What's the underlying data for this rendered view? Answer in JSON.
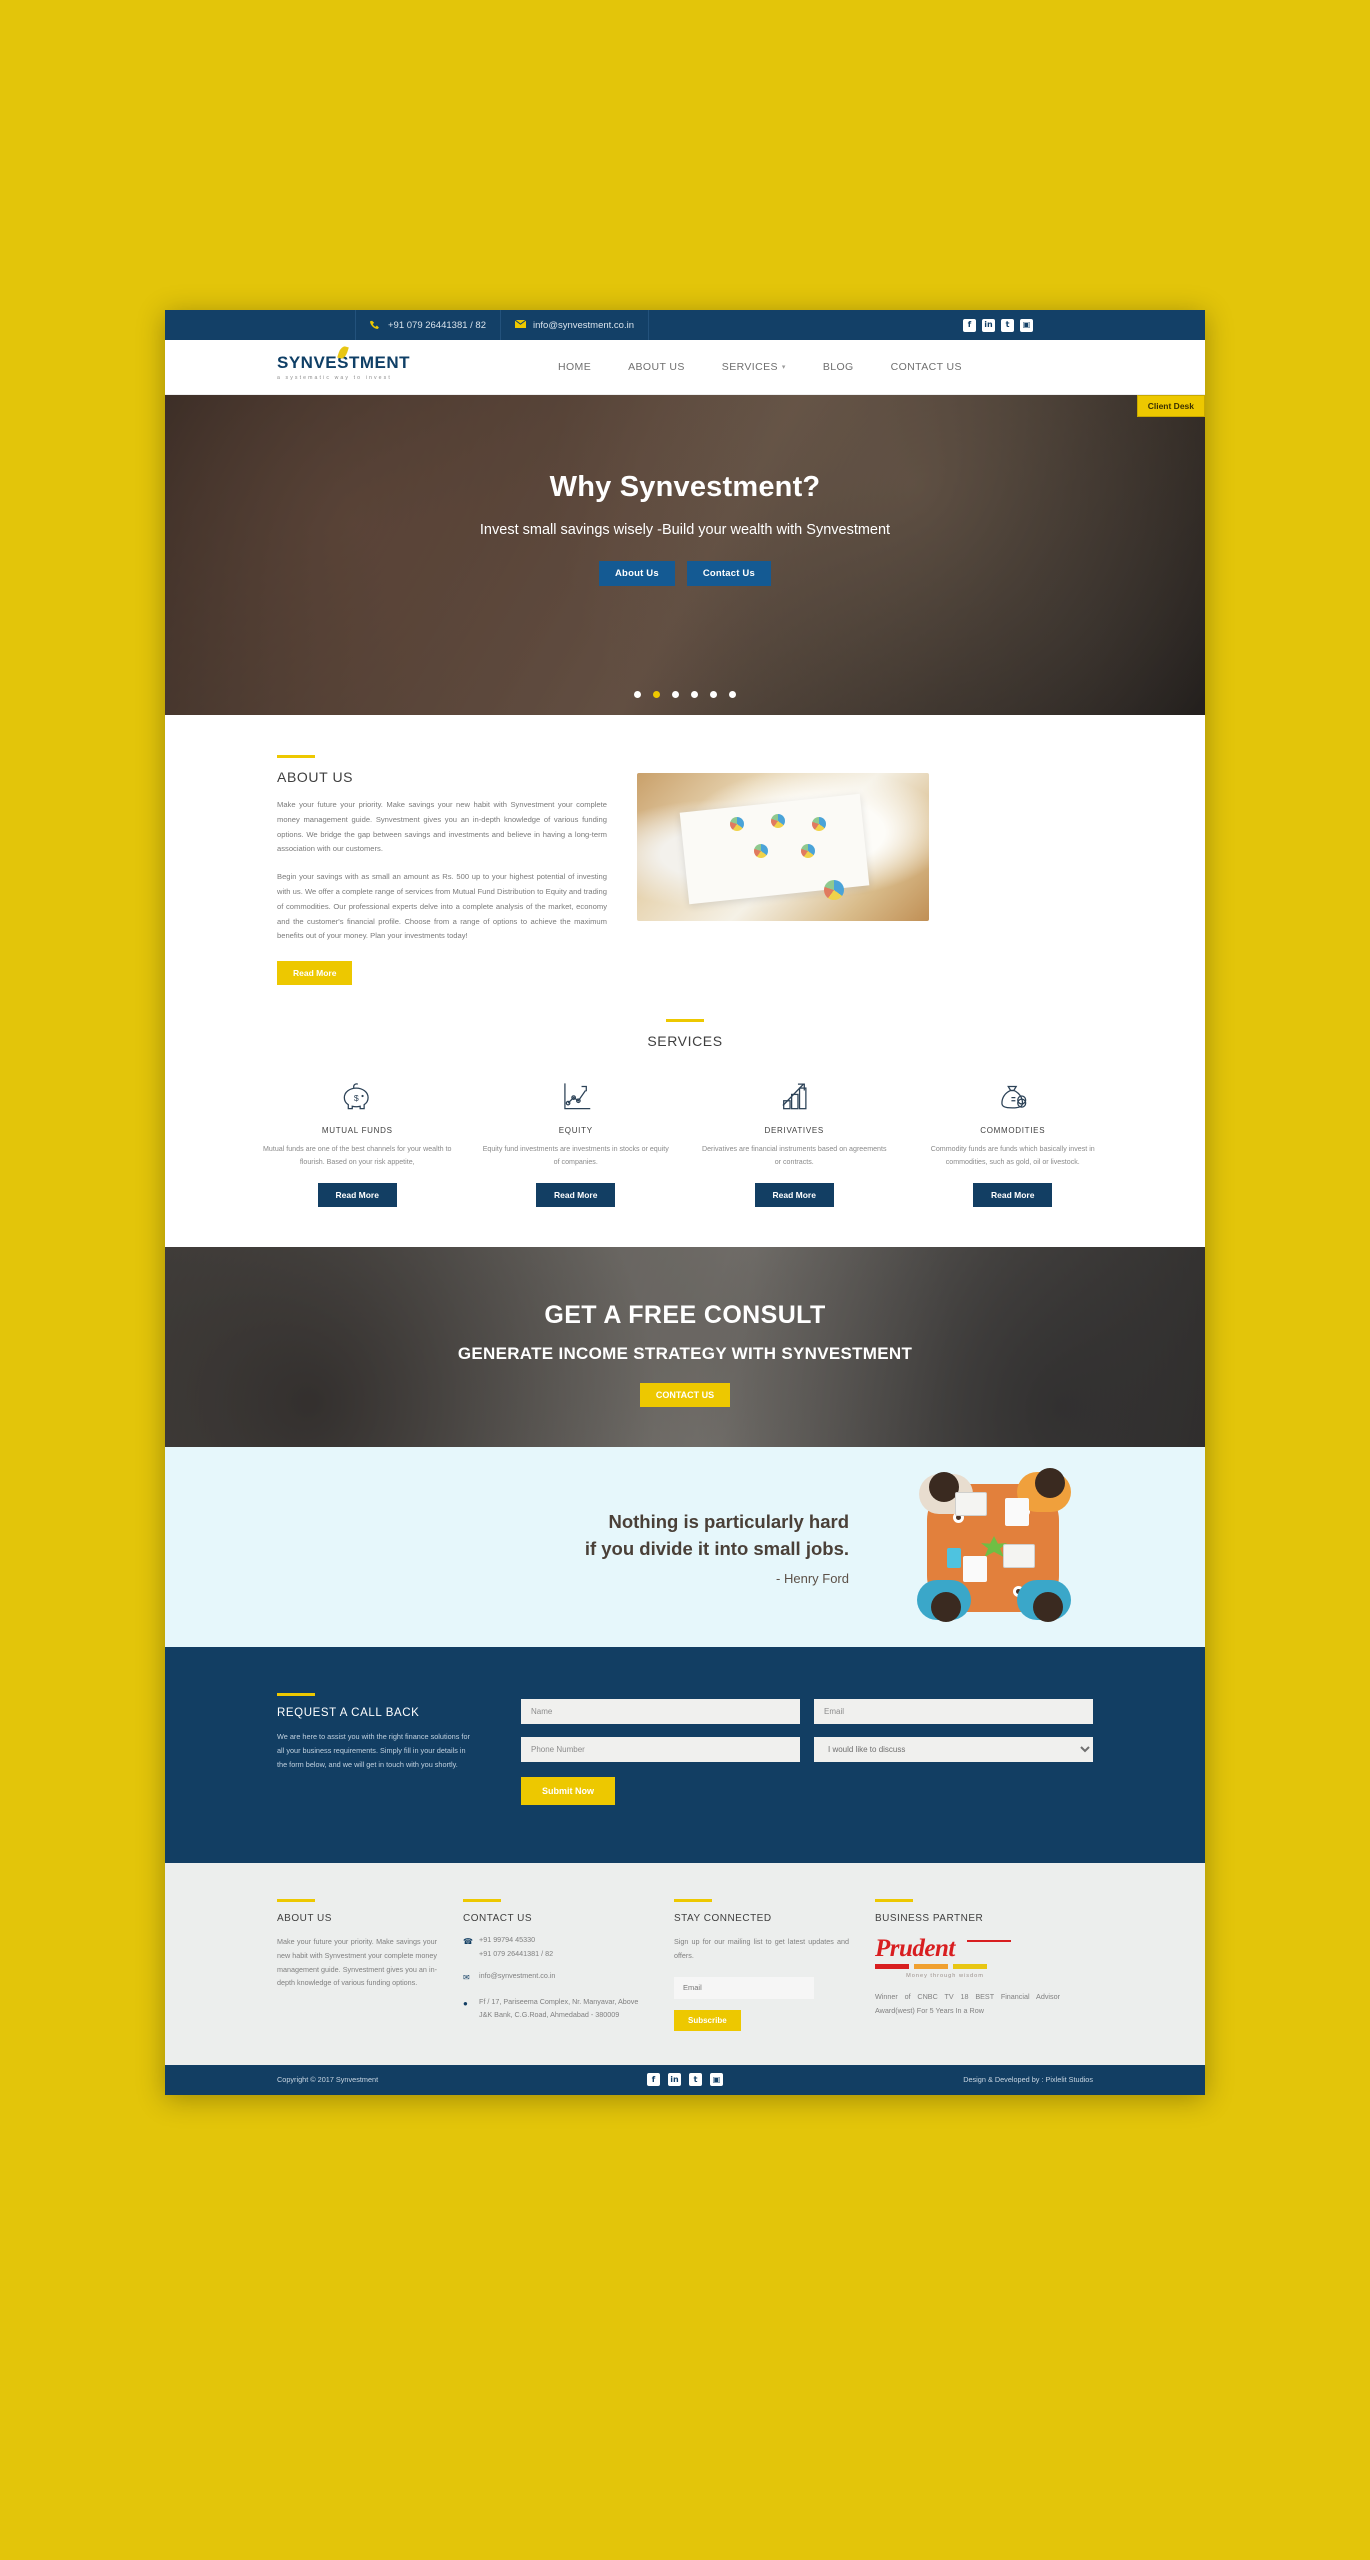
{
  "theme": {
    "navy": "#123e63",
    "yellow": "#edc800",
    "page_bg": "#e3c50a",
    "quote_bg": "#e6f7fb"
  },
  "topbar": {
    "phone": "+91 079 26441381 / 82",
    "email": "info@synvestment.co.in",
    "social": [
      {
        "name": "facebook-icon",
        "glyph": "f"
      },
      {
        "name": "linkedin-icon",
        "glyph": "in"
      },
      {
        "name": "twitter-icon",
        "glyph": "t"
      },
      {
        "name": "instagram-icon",
        "glyph": "▣"
      }
    ]
  },
  "nav": {
    "logo_word": "SYNVESTMENT",
    "logo_tagline": "a systematic way to invest",
    "items": [
      {
        "label": "HOME",
        "has_caret": false
      },
      {
        "label": "ABOUT US",
        "has_caret": false
      },
      {
        "label": "SERVICES",
        "has_caret": true
      },
      {
        "label": "BLOG",
        "has_caret": false
      },
      {
        "label": "CONTACT US",
        "has_caret": false
      }
    ],
    "client_desk": "Client Desk"
  },
  "hero": {
    "title": "Why Synvestment?",
    "subtitle": "Invest small savings wisely -Build your wealth with Synvestment",
    "btn_about": "About Us",
    "btn_contact": "Contact Us",
    "slides_total": 6,
    "active_slide": 2
  },
  "about": {
    "heading": "ABOUT US",
    "p1": "Make your future your priority. Make savings your new habit with Synvestment your complete money management guide. Synvestment gives you an in-depth knowledge of various funding options. We bridge the gap between savings and investments and believe in having a long-term association with our customers.",
    "p2": "Begin your savings with as small an amount as Rs. 500 up to your highest potential of investing with us. We offer a complete range of services from Mutual Fund Distribution to Equity and trading of commodities. Our professional experts delve into a complete analysis of the market, economy and the customer's financial profile. Choose from a range of options to achieve the maximum benefits out of your money. Plan your investments today!",
    "read_more": "Read More"
  },
  "services": {
    "heading": "SERVICES",
    "items": [
      {
        "icon": "piggy-bank-icon",
        "title": "MUTUAL FUNDS",
        "desc": "Mutual funds are one of the best channels for your wealth to flourish. Based on your risk appetite,",
        "btn": "Read More"
      },
      {
        "icon": "line-chart-icon",
        "title": "EQUITY",
        "desc": "Equity fund investments are investments in stocks or equity of companies.",
        "btn": "Read More"
      },
      {
        "icon": "bar-chart-arrow-icon",
        "title": "DERIVATIVES",
        "desc": "Derivatives are financial instruments based on agreements or contracts.",
        "btn": "Read More"
      },
      {
        "icon": "money-bag-icon",
        "title": "COMMODITIES",
        "desc": "Commodity funds are funds which basically invest in commodities, such as gold, oil or livestock.",
        "btn": "Read More"
      }
    ]
  },
  "consult": {
    "title": "GET A FREE CONSULT",
    "subtitle": "GENERATE INCOME STRATEGY WITH SYNVESTMENT",
    "btn": "CONTACT US"
  },
  "quote": {
    "line1": "Nothing is particularly hard",
    "line2": "if you divide it into small jobs.",
    "author": "- Henry Ford",
    "illustration": "team-meeting-table-illustration"
  },
  "callback": {
    "heading": "REQUEST A CALL BACK",
    "desc": "We are here to assist you with the right finance solutions for all your business requirements. Simply fill in your details in the form below, and we will get in touch with you shortly.",
    "name_placeholder": "Name",
    "email_placeholder": "Email",
    "phone_placeholder": "Phone Number",
    "topic_selected": "I would like to discuss",
    "submit": "Submit Now"
  },
  "footer": {
    "about": {
      "heading": "ABOUT US",
      "text": "Make your future your priority. Make savings your new habit with Synvestment your complete money management guide. Synvestment gives you an in-depth knowledge of various funding options."
    },
    "contact": {
      "heading": "CONTACT US",
      "phone1": "+91 99794 45330",
      "phone2": "+91 079 26441381 / 82",
      "email": "info@synvestment.co.in",
      "address": "Ff / 17, Pariseema Complex, Nr. Manyavar, Above J&K Bank, C.G.Road, Ahmedabad - 380009"
    },
    "stay": {
      "heading": "STAY CONNECTED",
      "text": "Sign up for our mailing list to get latest updates and offers.",
      "email_placeholder": "Email",
      "subscribe": "Subscribe"
    },
    "partner": {
      "heading": "BUSINESS PARTNER",
      "logo_word": "Prudent",
      "logo_tagline": "Money through wisdom",
      "award": "Winner of CNBC TV 18 BEST Financial Advisor Award(west) For 5 Years In a Row"
    }
  },
  "bottom": {
    "copyright": "Copyright © 2017 Synvestment",
    "credit": "Design & Developed by : Pixlelit Studios",
    "social": [
      {
        "name": "facebook-icon",
        "glyph": "f"
      },
      {
        "name": "linkedin-icon",
        "glyph": "in"
      },
      {
        "name": "twitter-icon",
        "glyph": "t"
      },
      {
        "name": "instagram-icon",
        "glyph": "▣"
      }
    ]
  }
}
